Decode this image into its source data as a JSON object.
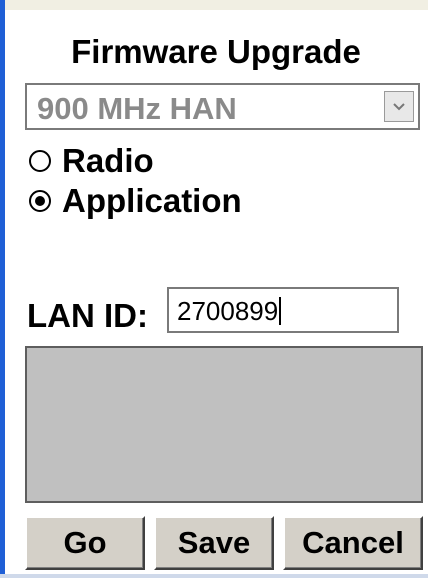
{
  "title": "Firmware Upgrade",
  "han_select": {
    "value": "900 MHz HAN"
  },
  "target": {
    "options": [
      {
        "label": "Radio",
        "checked": false
      },
      {
        "label": "Application",
        "checked": true
      }
    ]
  },
  "lan_id": {
    "label": "LAN ID:",
    "value": "2700899"
  },
  "buttons": {
    "go": "Go",
    "save": "Save",
    "cancel": "Cancel"
  },
  "colors": {
    "panel_border": "#1f5fd6",
    "button_face": "#d4d0c8",
    "status_area": "#c0c0c0"
  },
  "icons": {
    "dropdown": "chevron-down-icon"
  }
}
